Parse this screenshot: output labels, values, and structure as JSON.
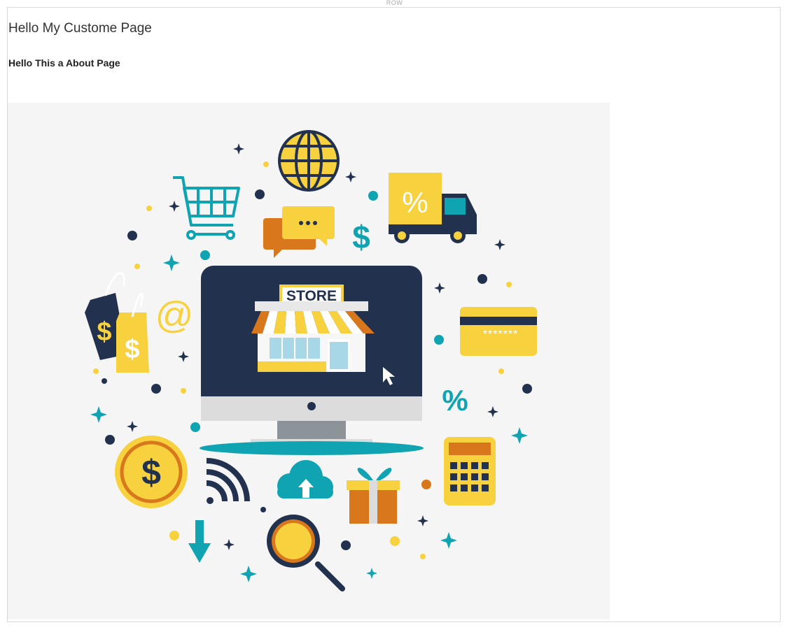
{
  "row_label": "ROW",
  "page": {
    "title": "Hello My Custome Page",
    "subtitle": "Hello This a About Page"
  },
  "illustration": {
    "store_sign": "STORE",
    "percent": "%",
    "dollar": "$",
    "at_sign": "@",
    "card_number": "*******",
    "colors": {
      "navy": "#22314d",
      "teal": "#10a3b1",
      "yellow": "#f7d23e",
      "orange": "#d9771d",
      "bg": "#f5f5f5"
    }
  }
}
